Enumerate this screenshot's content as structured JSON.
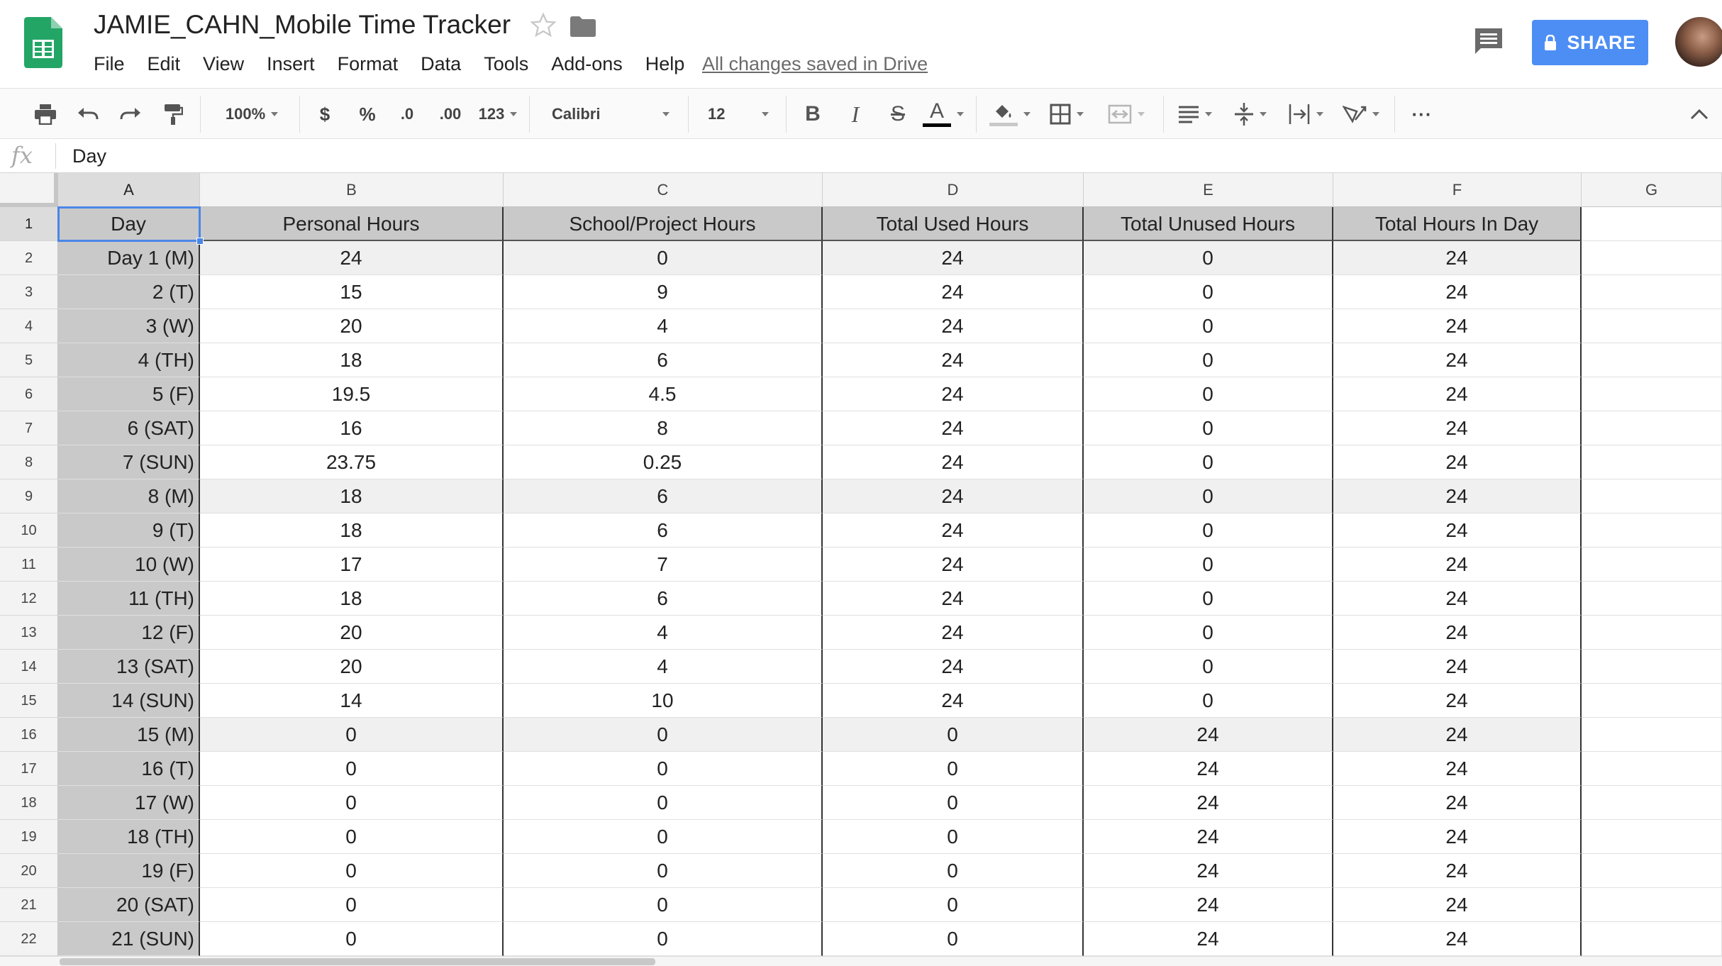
{
  "document": {
    "title": "JAMIE_CAHN_Mobile Time Tracker",
    "saved_status": "All changes saved in Drive"
  },
  "menu": [
    "File",
    "Edit",
    "View",
    "Insert",
    "Format",
    "Data",
    "Tools",
    "Add-ons",
    "Help"
  ],
  "share": {
    "label": "SHARE"
  },
  "toolbar": {
    "zoom": "100%",
    "currency": "$",
    "percent": "%",
    "decrease_decimal": ".0",
    "increase_decimal": ".00",
    "more_formats": "123",
    "font": "Calibri",
    "font_size": "12",
    "bold": "B",
    "italic": "I",
    "strikethrough": "S",
    "text_color": "A",
    "more": "···",
    "text_color_swatch": "#000000"
  },
  "formula_bar": {
    "fx": "fx",
    "value": "Day"
  },
  "colors": {
    "accent": "#4d8ef5",
    "selection": "#4a86e8",
    "header_fill": "#c9c9c9"
  },
  "columns": [
    "A",
    "B",
    "C",
    "D",
    "E",
    "F",
    "G"
  ],
  "rows": [
    [
      "Day",
      "Personal Hours",
      "School/Project Hours",
      "Total Used Hours",
      "Total Unused Hours",
      "Total Hours In Day"
    ],
    [
      "Day 1 (M)",
      "24",
      "0",
      "24",
      "0",
      "24"
    ],
    [
      "2 (T)",
      "15",
      "9",
      "24",
      "0",
      "24"
    ],
    [
      "3 (W)",
      "20",
      "4",
      "24",
      "0",
      "24"
    ],
    [
      "4 (TH)",
      "18",
      "6",
      "24",
      "0",
      "24"
    ],
    [
      "5 (F)",
      "19.5",
      "4.5",
      "24",
      "0",
      "24"
    ],
    [
      "6 (SAT)",
      "16",
      "8",
      "24",
      "0",
      "24"
    ],
    [
      "7 (SUN)",
      "23.75",
      "0.25",
      "24",
      "0",
      "24"
    ],
    [
      "8 (M)",
      "18",
      "6",
      "24",
      "0",
      "24"
    ],
    [
      "9 (T)",
      "18",
      "6",
      "24",
      "0",
      "24"
    ],
    [
      "10 (W)",
      "17",
      "7",
      "24",
      "0",
      "24"
    ],
    [
      "11 (TH)",
      "18",
      "6",
      "24",
      "0",
      "24"
    ],
    [
      "12 (F)",
      "20",
      "4",
      "24",
      "0",
      "24"
    ],
    [
      "13 (SAT)",
      "20",
      "4",
      "24",
      "0",
      "24"
    ],
    [
      "14 (SUN)",
      "14",
      "10",
      "24",
      "0",
      "24"
    ],
    [
      "15 (M)",
      "0",
      "0",
      "0",
      "24",
      "24"
    ],
    [
      "16 (T)",
      "0",
      "0",
      "0",
      "24",
      "24"
    ],
    [
      "17 (W)",
      "0",
      "0",
      "0",
      "24",
      "24"
    ],
    [
      "18 (TH)",
      "0",
      "0",
      "0",
      "24",
      "24"
    ],
    [
      "19 (F)",
      "0",
      "0",
      "0",
      "24",
      "24"
    ],
    [
      "20 (SAT)",
      "0",
      "0",
      "0",
      "24",
      "24"
    ],
    [
      "21 (SUN)",
      "0",
      "0",
      "0",
      "24",
      "24"
    ]
  ]
}
